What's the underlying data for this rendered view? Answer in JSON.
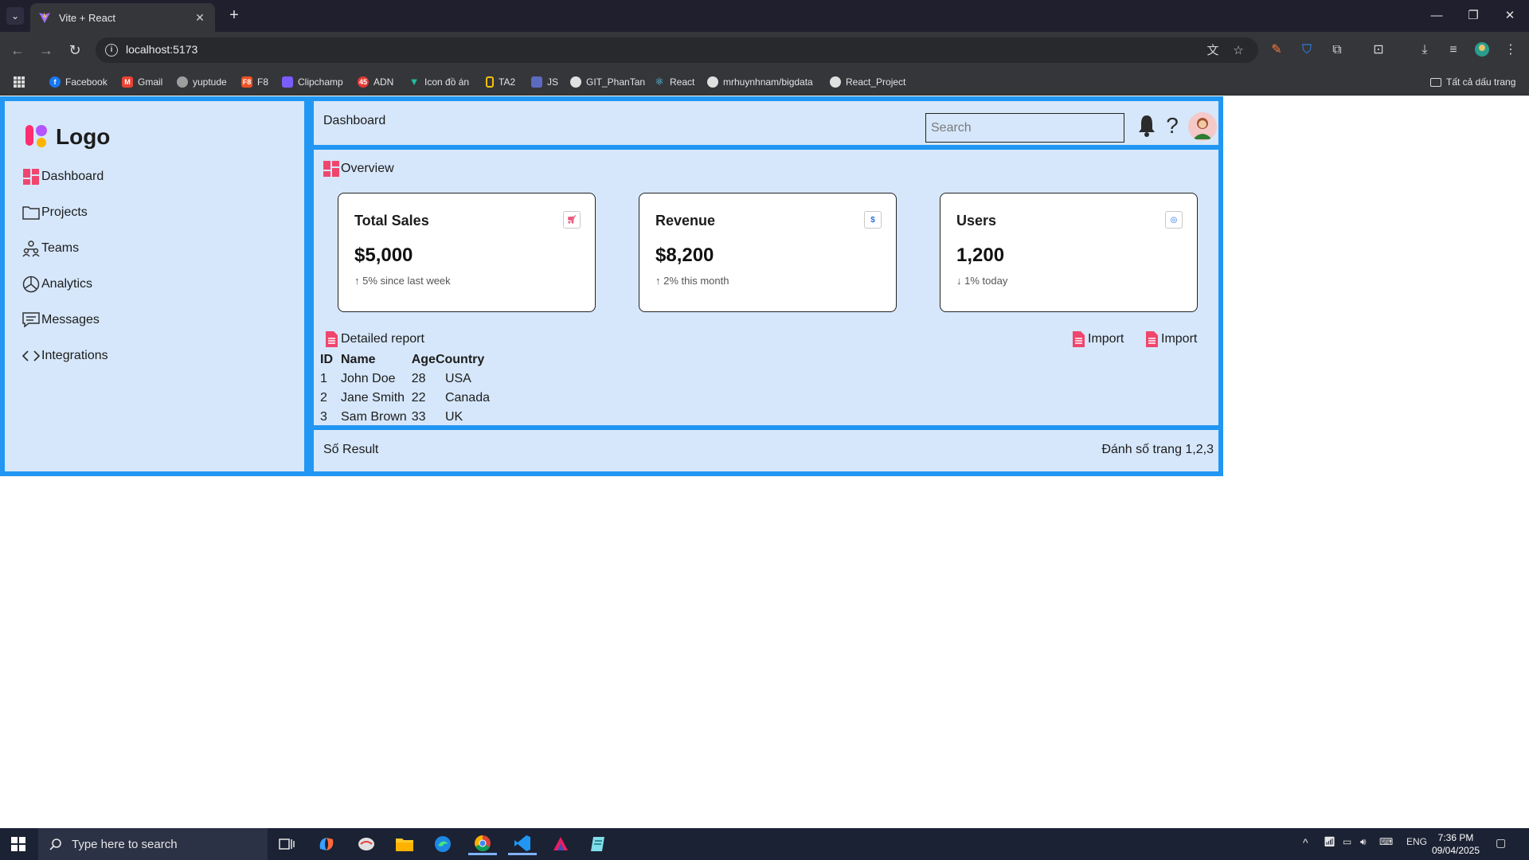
{
  "browser": {
    "tab_title": "Vite + React",
    "url": "localhost:5173",
    "bookmarks": [
      {
        "label": "Facebook",
        "icon": "facebook-icon",
        "color": "#1877f2"
      },
      {
        "label": "Gmail",
        "icon": "gmail-icon",
        "color": "#ea4335"
      },
      {
        "label": "yuptude",
        "icon": "globe-icon",
        "color": "#9e9e9e"
      },
      {
        "label": "F8",
        "icon": "f8-icon",
        "color": "#f05123"
      },
      {
        "label": "Clipchamp",
        "icon": "clipchamp-icon",
        "color": "#7b5cff"
      },
      {
        "label": "ADN",
        "icon": "adn-icon",
        "color": "#e53935"
      },
      {
        "label": "Icon đồ án",
        "icon": "vuetify-icon",
        "color": "#1fbd9c"
      },
      {
        "label": "TA2",
        "icon": "ta2-icon",
        "color": "#f4c20d"
      },
      {
        "label": "JS",
        "icon": "js-icon",
        "color": "#5c6bc0"
      },
      {
        "label": "GIT_PhanTan",
        "icon": "github-icon",
        "color": "#e0e0e0"
      },
      {
        "label": "React",
        "icon": "react-icon",
        "color": "#61dafb"
      },
      {
        "label": "mrhuynhnam/bigdata",
        "icon": "github-icon",
        "color": "#e0e0e0"
      },
      {
        "label": "React_Project",
        "icon": "github-icon",
        "color": "#e0e0e0"
      }
    ],
    "all_bookmarks": "Tất cả dấu trang"
  },
  "sidebar": {
    "logo_text": "Logo",
    "items": [
      {
        "label": "Dashboard",
        "icon": "dashboard-icon"
      },
      {
        "label": "Projects",
        "icon": "folder-icon"
      },
      {
        "label": "Teams",
        "icon": "teams-icon"
      },
      {
        "label": "Analytics",
        "icon": "analytics-icon"
      },
      {
        "label": "Messages",
        "icon": "messages-icon"
      },
      {
        "label": "Integrations",
        "icon": "code-icon"
      }
    ]
  },
  "header": {
    "title": "Dashboard",
    "search_placeholder": "Search"
  },
  "overview": {
    "title": "Overview",
    "cards": [
      {
        "title": "Total Sales",
        "value": "$5,000",
        "note": "↑ 5% since last week",
        "icon": "cart-icon",
        "icon_color": "#e8466b"
      },
      {
        "title": "Revenue",
        "value": "$8,200",
        "note": "↑ 2% this month",
        "icon": "dollar-icon",
        "icon_color": "#2f6fde"
      },
      {
        "title": "Users",
        "value": "1,200",
        "note": "↓ 1% today",
        "icon": "users-icon",
        "icon_color": "#2f6fde"
      }
    ]
  },
  "report": {
    "title": "Detailed report",
    "import_label_1": "Import",
    "import_label_2": "Import",
    "columns": [
      "ID",
      "Name",
      "Age",
      "Country"
    ],
    "rows": [
      [
        "1",
        "John Doe",
        "28",
        "USA"
      ],
      [
        "2",
        "Jane Smith",
        "22",
        "Canada"
      ],
      [
        "3",
        "Sam Brown",
        "33",
        "UK"
      ]
    ]
  },
  "footer": {
    "left": "Số Result",
    "right": "Đánh số trang 1,2,3"
  },
  "taskbar": {
    "search_placeholder": "Type here to search",
    "language": "ENG",
    "time": "7:36 PM",
    "date": "09/04/2025"
  },
  "colors": {
    "accent_border": "#2196f3",
    "panel_bg": "#d6e7fb",
    "pink_icon": "#e8466b"
  }
}
